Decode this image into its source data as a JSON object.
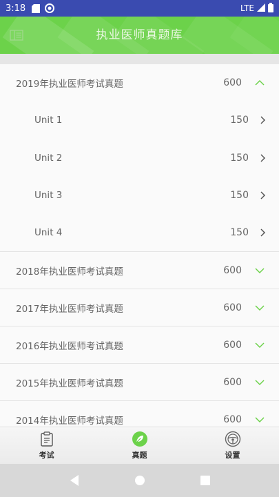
{
  "status_bar": {
    "time": "3:18",
    "network": "LTE"
  },
  "app_bar": {
    "title": "执业医师真题库"
  },
  "groups": [
    {
      "title": "2019年执业医师考试真题",
      "count": "600",
      "expanded": true,
      "units": [
        {
          "label": "Unit 1",
          "count": "150"
        },
        {
          "label": "Unit 2",
          "count": "150"
        },
        {
          "label": "Unit 3",
          "count": "150"
        },
        {
          "label": "Unit 4",
          "count": "150"
        }
      ]
    },
    {
      "title": "2018年执业医师考试真题",
      "count": "600",
      "expanded": false
    },
    {
      "title": "2017年执业医师考试真题",
      "count": "600",
      "expanded": false
    },
    {
      "title": "2016年执业医师考试真题",
      "count": "600",
      "expanded": false
    },
    {
      "title": "2015年执业医师考试真题",
      "count": "600",
      "expanded": false
    },
    {
      "title": "2014年执业医师考试真题",
      "count": "600",
      "expanded": false
    }
  ],
  "bottom_nav": [
    {
      "label": "考试",
      "icon": "exam-icon",
      "active": false
    },
    {
      "label": "真题",
      "icon": "leaf-icon",
      "active": true
    },
    {
      "label": "设置",
      "icon": "steering-wheel-icon",
      "active": false
    }
  ],
  "colors": {
    "accent": "#6cd24a",
    "status_bar": "#3a4bb0",
    "chevron": "#6cd24a"
  }
}
